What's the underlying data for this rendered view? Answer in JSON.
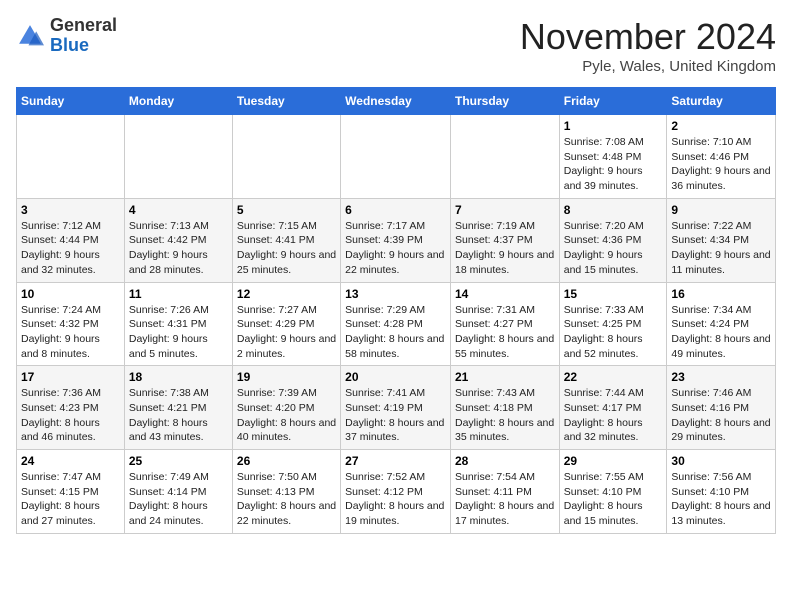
{
  "logo": {
    "general": "General",
    "blue": "Blue"
  },
  "header": {
    "month": "November 2024",
    "location": "Pyle, Wales, United Kingdom"
  },
  "weekdays": [
    "Sunday",
    "Monday",
    "Tuesday",
    "Wednesday",
    "Thursday",
    "Friday",
    "Saturday"
  ],
  "weeks": [
    [
      {
        "day": "",
        "info": ""
      },
      {
        "day": "",
        "info": ""
      },
      {
        "day": "",
        "info": ""
      },
      {
        "day": "",
        "info": ""
      },
      {
        "day": "",
        "info": ""
      },
      {
        "day": "1",
        "info": "Sunrise: 7:08 AM\nSunset: 4:48 PM\nDaylight: 9 hours and 39 minutes."
      },
      {
        "day": "2",
        "info": "Sunrise: 7:10 AM\nSunset: 4:46 PM\nDaylight: 9 hours and 36 minutes."
      }
    ],
    [
      {
        "day": "3",
        "info": "Sunrise: 7:12 AM\nSunset: 4:44 PM\nDaylight: 9 hours and 32 minutes."
      },
      {
        "day": "4",
        "info": "Sunrise: 7:13 AM\nSunset: 4:42 PM\nDaylight: 9 hours and 28 minutes."
      },
      {
        "day": "5",
        "info": "Sunrise: 7:15 AM\nSunset: 4:41 PM\nDaylight: 9 hours and 25 minutes."
      },
      {
        "day": "6",
        "info": "Sunrise: 7:17 AM\nSunset: 4:39 PM\nDaylight: 9 hours and 22 minutes."
      },
      {
        "day": "7",
        "info": "Sunrise: 7:19 AM\nSunset: 4:37 PM\nDaylight: 9 hours and 18 minutes."
      },
      {
        "day": "8",
        "info": "Sunrise: 7:20 AM\nSunset: 4:36 PM\nDaylight: 9 hours and 15 minutes."
      },
      {
        "day": "9",
        "info": "Sunrise: 7:22 AM\nSunset: 4:34 PM\nDaylight: 9 hours and 11 minutes."
      }
    ],
    [
      {
        "day": "10",
        "info": "Sunrise: 7:24 AM\nSunset: 4:32 PM\nDaylight: 9 hours and 8 minutes."
      },
      {
        "day": "11",
        "info": "Sunrise: 7:26 AM\nSunset: 4:31 PM\nDaylight: 9 hours and 5 minutes."
      },
      {
        "day": "12",
        "info": "Sunrise: 7:27 AM\nSunset: 4:29 PM\nDaylight: 9 hours and 2 minutes."
      },
      {
        "day": "13",
        "info": "Sunrise: 7:29 AM\nSunset: 4:28 PM\nDaylight: 8 hours and 58 minutes."
      },
      {
        "day": "14",
        "info": "Sunrise: 7:31 AM\nSunset: 4:27 PM\nDaylight: 8 hours and 55 minutes."
      },
      {
        "day": "15",
        "info": "Sunrise: 7:33 AM\nSunset: 4:25 PM\nDaylight: 8 hours and 52 minutes."
      },
      {
        "day": "16",
        "info": "Sunrise: 7:34 AM\nSunset: 4:24 PM\nDaylight: 8 hours and 49 minutes."
      }
    ],
    [
      {
        "day": "17",
        "info": "Sunrise: 7:36 AM\nSunset: 4:23 PM\nDaylight: 8 hours and 46 minutes."
      },
      {
        "day": "18",
        "info": "Sunrise: 7:38 AM\nSunset: 4:21 PM\nDaylight: 8 hours and 43 minutes."
      },
      {
        "day": "19",
        "info": "Sunrise: 7:39 AM\nSunset: 4:20 PM\nDaylight: 8 hours and 40 minutes."
      },
      {
        "day": "20",
        "info": "Sunrise: 7:41 AM\nSunset: 4:19 PM\nDaylight: 8 hours and 37 minutes."
      },
      {
        "day": "21",
        "info": "Sunrise: 7:43 AM\nSunset: 4:18 PM\nDaylight: 8 hours and 35 minutes."
      },
      {
        "day": "22",
        "info": "Sunrise: 7:44 AM\nSunset: 4:17 PM\nDaylight: 8 hours and 32 minutes."
      },
      {
        "day": "23",
        "info": "Sunrise: 7:46 AM\nSunset: 4:16 PM\nDaylight: 8 hours and 29 minutes."
      }
    ],
    [
      {
        "day": "24",
        "info": "Sunrise: 7:47 AM\nSunset: 4:15 PM\nDaylight: 8 hours and 27 minutes."
      },
      {
        "day": "25",
        "info": "Sunrise: 7:49 AM\nSunset: 4:14 PM\nDaylight: 8 hours and 24 minutes."
      },
      {
        "day": "26",
        "info": "Sunrise: 7:50 AM\nSunset: 4:13 PM\nDaylight: 8 hours and 22 minutes."
      },
      {
        "day": "27",
        "info": "Sunrise: 7:52 AM\nSunset: 4:12 PM\nDaylight: 8 hours and 19 minutes."
      },
      {
        "day": "28",
        "info": "Sunrise: 7:54 AM\nSunset: 4:11 PM\nDaylight: 8 hours and 17 minutes."
      },
      {
        "day": "29",
        "info": "Sunrise: 7:55 AM\nSunset: 4:10 PM\nDaylight: 8 hours and 15 minutes."
      },
      {
        "day": "30",
        "info": "Sunrise: 7:56 AM\nSunset: 4:10 PM\nDaylight: 8 hours and 13 minutes."
      }
    ]
  ]
}
